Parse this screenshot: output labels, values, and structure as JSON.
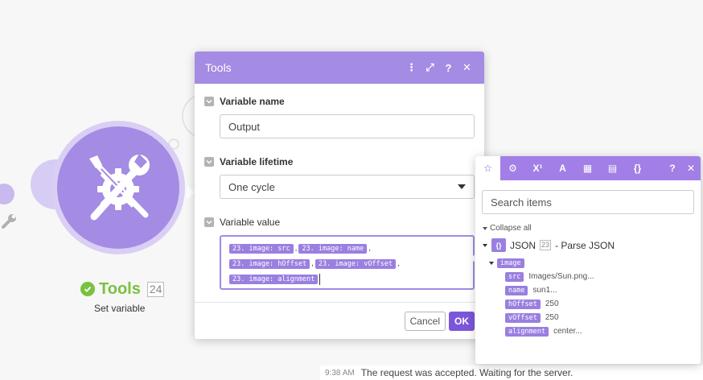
{
  "module": {
    "name": "Tools",
    "badge": "24",
    "subtitle": "Set variable",
    "icon": "tools-cross-wrench-screwdriver-gear-icon",
    "status_icon": "check-circle-icon",
    "color": "#a48be3",
    "status_color": "#7ac142"
  },
  "dialog": {
    "title": "Tools",
    "header_icons": [
      "more-vertical-icon",
      "expand-icon",
      "help-icon",
      "close-icon"
    ],
    "header_glyphs": {
      "more": "⋮",
      "expand": "⤢",
      "help": "?",
      "close": "✕"
    },
    "fields": {
      "variable_name": {
        "label": "Variable name",
        "value": "Output"
      },
      "variable_lifetime": {
        "label": "Variable lifetime",
        "value": "One cycle"
      },
      "variable_value": {
        "label": "Variable value",
        "tokens": [
          [
            "23. image: src",
            "23. image: name"
          ],
          [
            "23. image: hOffset",
            "23. image: vOffset"
          ],
          [
            "23. image: alignment"
          ]
        ],
        "separator": ","
      }
    },
    "buttons": {
      "cancel": "Cancel",
      "ok": "OK"
    },
    "accent": "#7b56d9"
  },
  "mapper": {
    "tabs": [
      {
        "icon": "star-icon",
        "glyph": "☆",
        "active": true
      },
      {
        "icon": "gear-icon",
        "glyph": "⚙",
        "active": false
      },
      {
        "icon": "superscript-icon",
        "glyph": "X¹",
        "active": false
      },
      {
        "icon": "text-icon",
        "glyph": "A",
        "active": false
      },
      {
        "icon": "calendar-icon",
        "glyph": "▦",
        "active": false
      },
      {
        "icon": "table-icon",
        "glyph": "▤",
        "active": false
      },
      {
        "icon": "braces-icon",
        "glyph": "{}",
        "active": false
      }
    ],
    "help_glyph": "?",
    "close_glyph": "✕",
    "search_placeholder": "Search items",
    "collapse_label": "Collapse all",
    "root": {
      "icon_glyph": "{}",
      "label": "JSON",
      "badge": "23",
      "suffix": "- Parse JSON"
    },
    "node": {
      "name": "image"
    },
    "leaves": [
      {
        "name": "src",
        "value": "Images/Sun.png..."
      },
      {
        "name": "name",
        "value": "sun1..."
      },
      {
        "name": "hOffset",
        "value": "250"
      },
      {
        "name": "vOffset",
        "value": "250"
      },
      {
        "name": "alignment",
        "value": "center..."
      }
    ],
    "tab_color": "#a27fe6"
  },
  "log": {
    "time": "9:38 AM",
    "text": "The request was accepted. Waiting for the server."
  }
}
